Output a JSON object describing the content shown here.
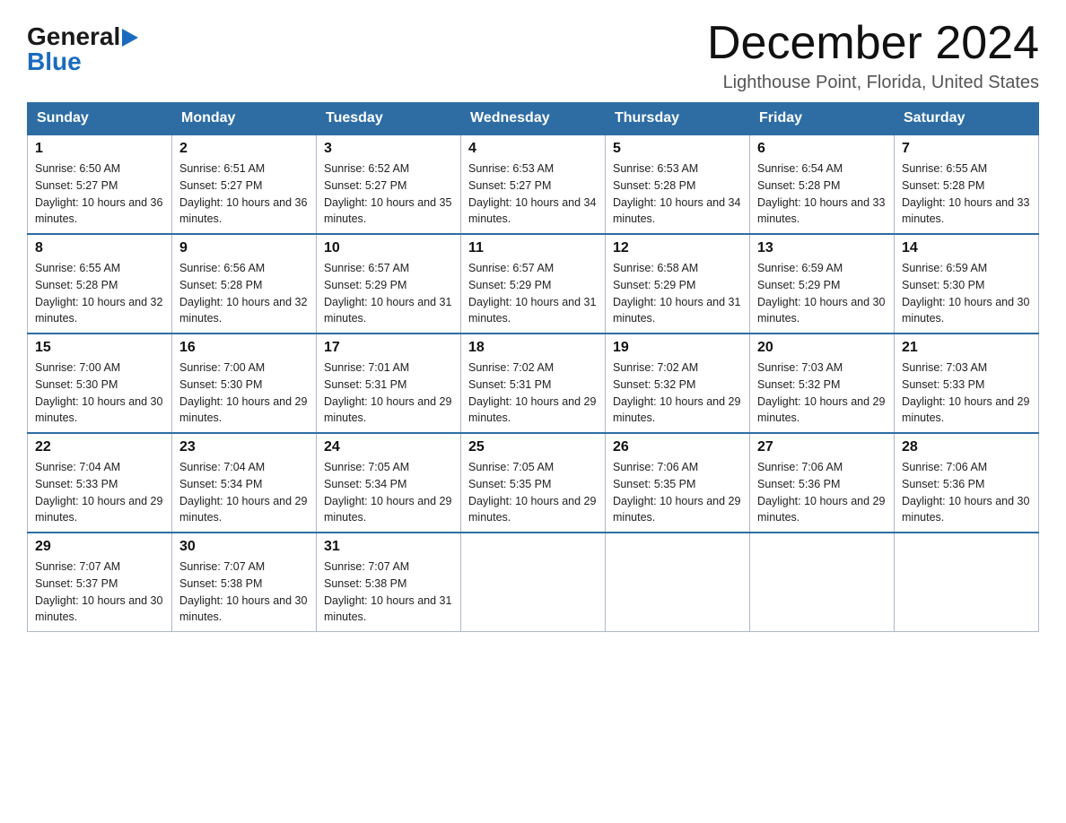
{
  "header": {
    "logo": {
      "text_general": "General",
      "text_blue": "Blue",
      "arrow_color": "#1a6bbf"
    },
    "title": "December 2024",
    "subtitle": "Lighthouse Point, Florida, United States"
  },
  "weekdays": [
    "Sunday",
    "Monday",
    "Tuesday",
    "Wednesday",
    "Thursday",
    "Friday",
    "Saturday"
  ],
  "weeks": [
    [
      {
        "day": "1",
        "sunrise": "6:50 AM",
        "sunset": "5:27 PM",
        "daylight": "10 hours and 36 minutes."
      },
      {
        "day": "2",
        "sunrise": "6:51 AM",
        "sunset": "5:27 PM",
        "daylight": "10 hours and 36 minutes."
      },
      {
        "day": "3",
        "sunrise": "6:52 AM",
        "sunset": "5:27 PM",
        "daylight": "10 hours and 35 minutes."
      },
      {
        "day": "4",
        "sunrise": "6:53 AM",
        "sunset": "5:27 PM",
        "daylight": "10 hours and 34 minutes."
      },
      {
        "day": "5",
        "sunrise": "6:53 AM",
        "sunset": "5:28 PM",
        "daylight": "10 hours and 34 minutes."
      },
      {
        "day": "6",
        "sunrise": "6:54 AM",
        "sunset": "5:28 PM",
        "daylight": "10 hours and 33 minutes."
      },
      {
        "day": "7",
        "sunrise": "6:55 AM",
        "sunset": "5:28 PM",
        "daylight": "10 hours and 33 minutes."
      }
    ],
    [
      {
        "day": "8",
        "sunrise": "6:55 AM",
        "sunset": "5:28 PM",
        "daylight": "10 hours and 32 minutes."
      },
      {
        "day": "9",
        "sunrise": "6:56 AM",
        "sunset": "5:28 PM",
        "daylight": "10 hours and 32 minutes."
      },
      {
        "day": "10",
        "sunrise": "6:57 AM",
        "sunset": "5:29 PM",
        "daylight": "10 hours and 31 minutes."
      },
      {
        "day": "11",
        "sunrise": "6:57 AM",
        "sunset": "5:29 PM",
        "daylight": "10 hours and 31 minutes."
      },
      {
        "day": "12",
        "sunrise": "6:58 AM",
        "sunset": "5:29 PM",
        "daylight": "10 hours and 31 minutes."
      },
      {
        "day": "13",
        "sunrise": "6:59 AM",
        "sunset": "5:29 PM",
        "daylight": "10 hours and 30 minutes."
      },
      {
        "day": "14",
        "sunrise": "6:59 AM",
        "sunset": "5:30 PM",
        "daylight": "10 hours and 30 minutes."
      }
    ],
    [
      {
        "day": "15",
        "sunrise": "7:00 AM",
        "sunset": "5:30 PM",
        "daylight": "10 hours and 30 minutes."
      },
      {
        "day": "16",
        "sunrise": "7:00 AM",
        "sunset": "5:30 PM",
        "daylight": "10 hours and 29 minutes."
      },
      {
        "day": "17",
        "sunrise": "7:01 AM",
        "sunset": "5:31 PM",
        "daylight": "10 hours and 29 minutes."
      },
      {
        "day": "18",
        "sunrise": "7:02 AM",
        "sunset": "5:31 PM",
        "daylight": "10 hours and 29 minutes."
      },
      {
        "day": "19",
        "sunrise": "7:02 AM",
        "sunset": "5:32 PM",
        "daylight": "10 hours and 29 minutes."
      },
      {
        "day": "20",
        "sunrise": "7:03 AM",
        "sunset": "5:32 PM",
        "daylight": "10 hours and 29 minutes."
      },
      {
        "day": "21",
        "sunrise": "7:03 AM",
        "sunset": "5:33 PM",
        "daylight": "10 hours and 29 minutes."
      }
    ],
    [
      {
        "day": "22",
        "sunrise": "7:04 AM",
        "sunset": "5:33 PM",
        "daylight": "10 hours and 29 minutes."
      },
      {
        "day": "23",
        "sunrise": "7:04 AM",
        "sunset": "5:34 PM",
        "daylight": "10 hours and 29 minutes."
      },
      {
        "day": "24",
        "sunrise": "7:05 AM",
        "sunset": "5:34 PM",
        "daylight": "10 hours and 29 minutes."
      },
      {
        "day": "25",
        "sunrise": "7:05 AM",
        "sunset": "5:35 PM",
        "daylight": "10 hours and 29 minutes."
      },
      {
        "day": "26",
        "sunrise": "7:06 AM",
        "sunset": "5:35 PM",
        "daylight": "10 hours and 29 minutes."
      },
      {
        "day": "27",
        "sunrise": "7:06 AM",
        "sunset": "5:36 PM",
        "daylight": "10 hours and 29 minutes."
      },
      {
        "day": "28",
        "sunrise": "7:06 AM",
        "sunset": "5:36 PM",
        "daylight": "10 hours and 30 minutes."
      }
    ],
    [
      {
        "day": "29",
        "sunrise": "7:07 AM",
        "sunset": "5:37 PM",
        "daylight": "10 hours and 30 minutes."
      },
      {
        "day": "30",
        "sunrise": "7:07 AM",
        "sunset": "5:38 PM",
        "daylight": "10 hours and 30 minutes."
      },
      {
        "day": "31",
        "sunrise": "7:07 AM",
        "sunset": "5:38 PM",
        "daylight": "10 hours and 31 minutes."
      },
      null,
      null,
      null,
      null
    ]
  ]
}
